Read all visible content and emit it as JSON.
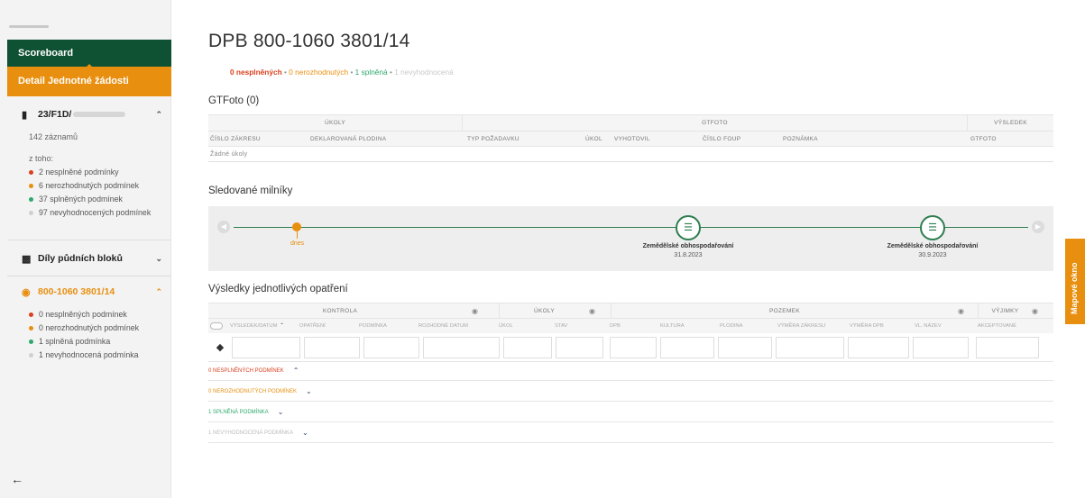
{
  "sidebar": {
    "scoreboard": "Scoreboard",
    "detail": "Detail Jednotné žádosti",
    "section1": {
      "title": "23/F1D/",
      "records": "142 záznamů",
      "subtitle": "z toho:",
      "items": [
        {
          "label": "2 nesplněné podmínky",
          "color": "#d9411e"
        },
        {
          "label": "6 nerozhodnutých podmínek",
          "color": "#e88f0f"
        },
        {
          "label": "37 splněných podmínek",
          "color": "#2fa86b"
        },
        {
          "label": "97 nevyhodnocených podmínek",
          "color": "#d0d0d0"
        }
      ]
    },
    "section2": {
      "title": "Díly půdních bloků"
    },
    "section3": {
      "title": "800-1060 3801/14",
      "items": [
        {
          "label": "0 nesplněných podmínek",
          "color": "#d9411e"
        },
        {
          "label": "0 nerozhodnutých podmínek",
          "color": "#e88f0f"
        },
        {
          "label": "1 splněná podmínka",
          "color": "#2fa86b"
        },
        {
          "label": "1 nevyhodnocená podmínka",
          "color": "#d0d0d0"
        }
      ]
    },
    "back_icon": "arrow-left-icon"
  },
  "main": {
    "title": "DPB 800-1060 3801/14",
    "stats": {
      "unfulfilled": "0 nesplněných",
      "undecided": "0 nerozhodnutých",
      "fulfilled": "1 splněná",
      "unevaluated": "1 nevyhodnocená",
      "separator": "•"
    },
    "gtfoto": {
      "title": "GTFoto (0)",
      "groups": [
        "ÚKOLY",
        "GTFOTO",
        "VÝSLEDEK"
      ],
      "columns": [
        "ČÍSLO ZÁKRESU",
        "DEKLAROVANÁ PLODINA",
        "TYP POŽADAVKU",
        "ÚKOL",
        "VYHOTOVIL",
        "ČÍSLO FOUP",
        "POZNÁMKA",
        "GTFOTO"
      ],
      "empty": "Žádné úkoly"
    },
    "milestones": {
      "title": "Sledované milníky",
      "today": "dnes",
      "items": [
        {
          "label": "Zemědělské obhospodařování",
          "date": "31.8.2023"
        },
        {
          "label": "Zemědělské obhospodařování",
          "date": "30.9.2023"
        }
      ]
    },
    "results": {
      "title": "Výsledky jednotlivých opatření",
      "groups": [
        "KONTROLA",
        "ÚKOLY",
        "POZEMEK",
        "VÝJIMKY"
      ],
      "columns": [
        "VÝSLEDEK/DATUM",
        "OPATŘENÍ",
        "PODMÍNKA",
        "ROZHODNÉ DATUM",
        "ÚKOL",
        "STAV",
        "DPB",
        "KULTURA",
        "PLODINA",
        "VÝMĚRA ZÁKRESU",
        "VÝMĚRA DPB",
        "VL. NÁZEV",
        "AKCEPTOVANÉ"
      ],
      "conditions": [
        {
          "label": "0 NESPLNĚNÝCH PODMÍNEK",
          "color": "#d9411e",
          "chevron": "^"
        },
        {
          "label": "0 NEROZHODNUTÝCH PODMÍNEK",
          "color": "#e88f0f",
          "chevron": "v"
        },
        {
          "label": "1 SPLNĚNÁ PODMÍNKA",
          "color": "#2fa86b",
          "chevron": "v"
        },
        {
          "label": "1 NEVYHODNOCENÁ PODMÍNKA",
          "color": "#bbbbbb",
          "chevron": "v"
        }
      ]
    }
  },
  "side_tab": {
    "label": "Mapové okno"
  }
}
